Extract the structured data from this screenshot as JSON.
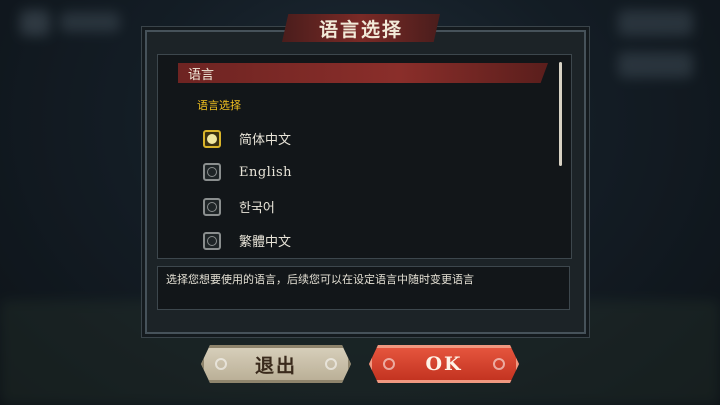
{
  "dialog": {
    "title": "语言选择",
    "section_label": "语言",
    "sub_heading": "语言选择",
    "options": [
      {
        "label": "简体中文",
        "selected": true
      },
      {
        "label": "English",
        "selected": false
      },
      {
        "label": "한국어",
        "selected": false
      },
      {
        "label": "繁體中文",
        "selected": false
      }
    ],
    "description": "选择您想要使用的语言，后续您可以在设定语言中随时变更语言"
  },
  "buttons": {
    "exit_label": "退出",
    "ok_label": "OK"
  },
  "colors": {
    "accent_red": "#8a2e2a",
    "highlight_yellow": "#f0c020",
    "ok_button": "#e04a34",
    "exit_button": "#cfc6b0"
  }
}
